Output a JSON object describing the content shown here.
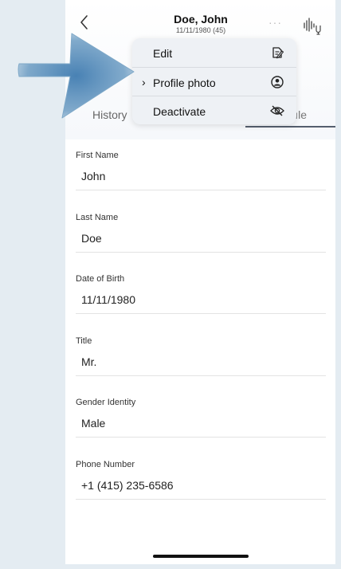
{
  "header": {
    "back_icon": "chevron-left-icon",
    "name": "Doe, John",
    "subtitle": "11/11/1980 (45)",
    "more_icon": "more-dots-icon",
    "voice_icon": "voice-waveform-icon"
  },
  "tabs": [
    {
      "label": "History"
    },
    {
      "label": "Profile",
      "visible_text": "ıle"
    }
  ],
  "menu": {
    "items": [
      {
        "label": "Edit",
        "icon": "edit-icon"
      },
      {
        "label": "Profile photo",
        "icon": "profile-photo-icon",
        "chevron": "›"
      },
      {
        "label": "Deactivate",
        "icon": "eye-slash-icon"
      }
    ]
  },
  "fields": [
    {
      "label": "First Name",
      "value": "John"
    },
    {
      "label": "Last Name",
      "value": "Doe"
    },
    {
      "label": "Date of Birth",
      "value": "11/11/1980"
    },
    {
      "label": "Title",
      "value": "Mr."
    },
    {
      "label": "Gender Identity",
      "value": "Male"
    },
    {
      "label": "Phone Number",
      "value": "+1 (415) 235-6586"
    }
  ],
  "colors": {
    "background": "#e4ecf2",
    "menu_bg": "#eef1f5",
    "pointer_arrow": "#5b8fba",
    "tab_underline": "#555f6e"
  }
}
